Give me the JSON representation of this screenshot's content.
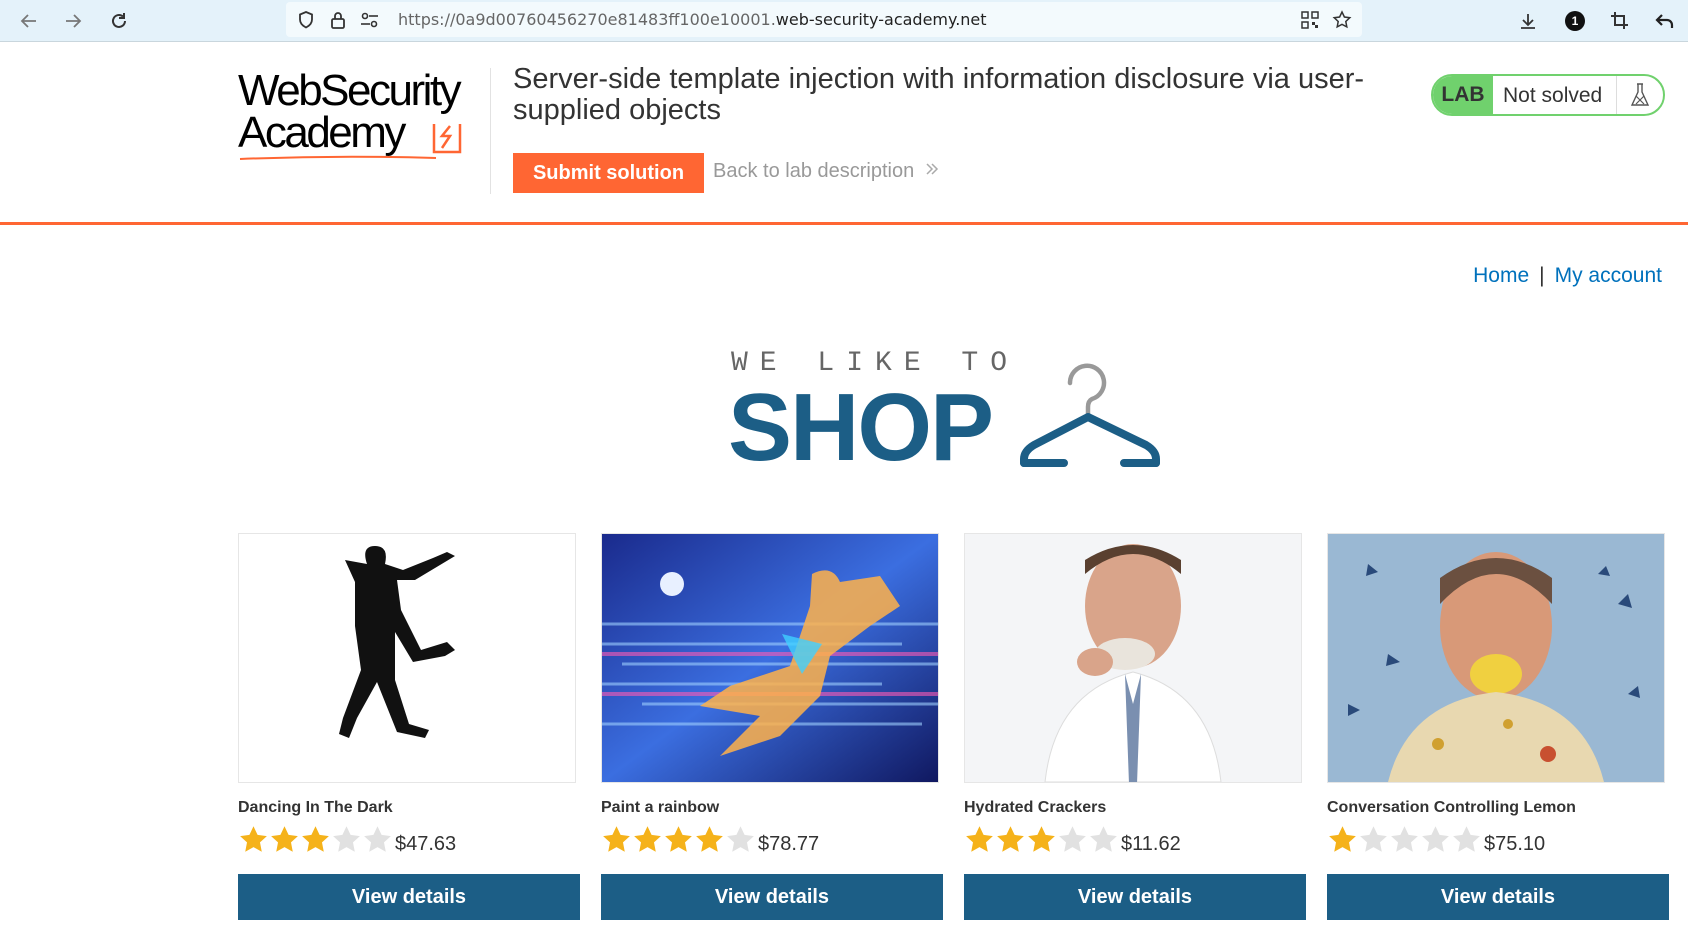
{
  "browser": {
    "url_prefix": "https://0a9d00760456270e81483ff100e10001.",
    "url_domain": "web-security-academy.net",
    "notification_count": "1"
  },
  "logo": {
    "line1": "WebSecurity",
    "line2": "Academy"
  },
  "lab": {
    "title": "Server-side template injection with information disclosure via user-supplied objects",
    "submit_label": "Submit solution",
    "back_label": "Back to lab description",
    "badge": "LAB",
    "status": "Not solved",
    "status_color": "#70d16d",
    "accent_color": "#ff6633"
  },
  "nav": {
    "home": "Home",
    "separator": "|",
    "account": "My account"
  },
  "banner": {
    "top": "WE LIKE TO",
    "main": "SHOP"
  },
  "products": [
    {
      "name": "Dancing In The Dark",
      "rating": 3,
      "price": "$47.63",
      "button": "View details",
      "image": "dancing-silhouette"
    },
    {
      "name": "Paint a rainbow",
      "rating": 4,
      "price": "$78.77",
      "button": "View details",
      "image": "rainbow-runner"
    },
    {
      "name": "Hydrated Crackers",
      "rating": 3,
      "price": "$11.62",
      "button": "View details",
      "image": "man-eating-cracker"
    },
    {
      "name": "Conversation Controlling Lemon",
      "rating": 1,
      "price": "$75.10",
      "button": "View details",
      "image": "man-with-lemon"
    }
  ]
}
